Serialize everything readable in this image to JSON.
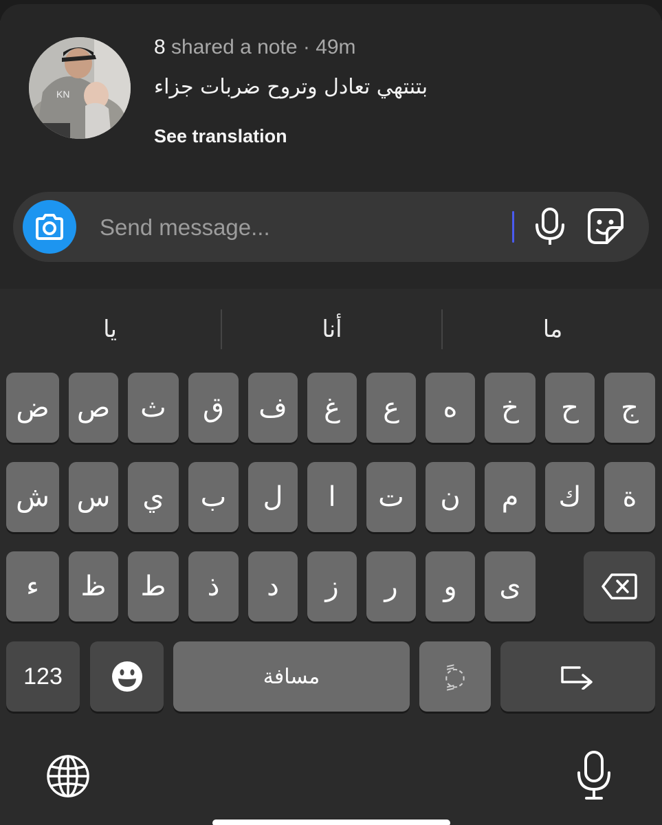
{
  "note": {
    "author": "8",
    "action": "shared a note",
    "separator": " · ",
    "time": "49m",
    "text": "بتنتهي تعادل وتروح ضربات جزاء",
    "see_translation": "See translation"
  },
  "composer": {
    "placeholder": "Send message...",
    "value": "",
    "camera_icon": "camera-icon",
    "mic_icon": "microphone-icon",
    "sticker_icon": "sticker-icon",
    "accent": "#1d95f0"
  },
  "keyboard": {
    "suggestions": [
      "يا",
      "أنا",
      "ما"
    ],
    "rows": [
      [
        "ض",
        "ص",
        "ث",
        "ق",
        "ف",
        "غ",
        "ع",
        "ه",
        "خ",
        "ح",
        "ج"
      ],
      [
        "ش",
        "س",
        "ي",
        "ب",
        "ل",
        "ا",
        "ت",
        "ن",
        "م",
        "ك",
        "ة"
      ],
      [
        "ء",
        "ظ",
        "ط",
        "ذ",
        "د",
        "ز",
        "ر",
        "و",
        "ى"
      ]
    ],
    "numbers_label": "123",
    "space_label": "مسافة",
    "diacritic_label": "ًٍ◌",
    "emoji_icon": "emoji-icon",
    "backspace_icon": "backspace-icon",
    "return_icon": "return-icon",
    "globe_icon": "globe-icon",
    "dictation_icon": "microphone-icon"
  }
}
